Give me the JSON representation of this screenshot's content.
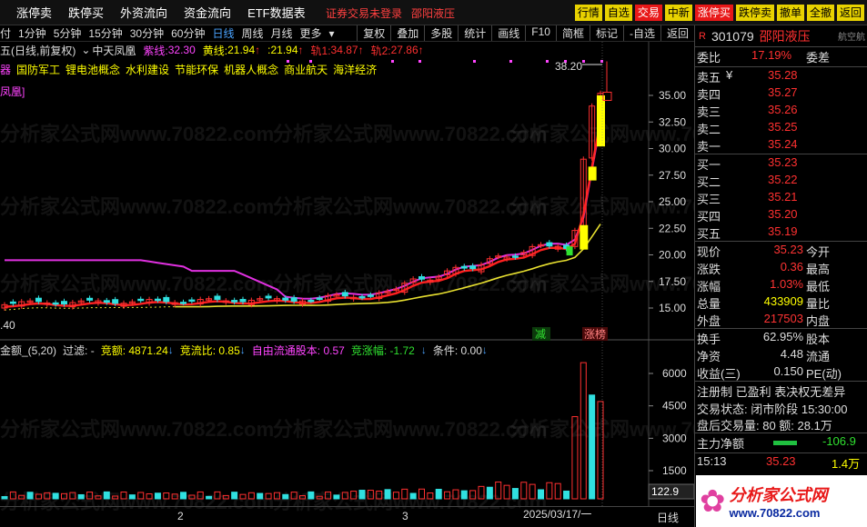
{
  "menu": [
    "涨停卖",
    "跌停买",
    "外资流向",
    "资金流向",
    "ETF数据表"
  ],
  "menu_tools": {
    "notice": "证券交易未登录",
    "stock": "邵阳液压"
  },
  "menu_buttons": [
    "行情",
    "自选",
    "交易",
    "中新",
    "涨停买",
    "跌停卖",
    "撤单",
    "全撤",
    "返回"
  ],
  "periods": [
    "付",
    "1分钟",
    "5分钟",
    "15分钟",
    "30分钟",
    "60分钟",
    "日线",
    "周线",
    "月线",
    "更多"
  ],
  "active_period": "日线",
  "chart_buttons": [
    "复权",
    "叠加",
    "多股",
    "统计",
    "画线",
    "F10",
    "简框",
    "标记",
    "-自选",
    "返回"
  ],
  "ma": {
    "title": "五(日线,前复权)",
    "fenghuang": "中天凤凰",
    "zi_label": "紫线:",
    "zi": "32.30",
    "huang_label": "黄线:",
    "huang": "21.94",
    "sep": ":",
    "sep_val": "21.94",
    "gui1_label": "轨1:",
    "gui1": "34.87",
    "gui2_label": "轨2:",
    "gui2": "27.86",
    "arrow": "↑"
  },
  "concepts": [
    "国防军工",
    "锂电池概念",
    "水利建设",
    "节能环保",
    "机器人概念",
    "商业航天",
    "海洋经济"
  ],
  "concept_prefix": "器",
  "feng_label": "凤凰]",
  "price_axis": [
    "35.00",
    "32.50",
    "30.00",
    "27.50",
    "25.00",
    "22.50",
    "20.00",
    "17.50",
    "15.00"
  ],
  "high_label": "38.20",
  "low_label": ".40",
  "tags": {
    "jian": "减",
    "zhangting": "涨榜"
  },
  "indicator": {
    "name": "金额_(5,20)",
    "filter": "过滤: -",
    "jingxiao": "竞额: 4871.24",
    "arr1": "↓",
    "jlb": "竞流比: 0.85",
    "arr2": "↓",
    "zyltgb": "自由流通股本: 0.57",
    "jzf": "竞涨幅: -1.72",
    "arr3": "↓",
    "cond": "条件: 0.00",
    "arr4": "↓"
  },
  "vol_axis": [
    "6000",
    "4500",
    "3000",
    "1500"
  ],
  "vol_last": "122.9",
  "date_label": "2025/03/17/一",
  "month_labels": [
    "2",
    "3"
  ],
  "bottom_right": "日线",
  "watermark": "分析家公式网www.70822.com",
  "rp": {
    "code": "301079",
    "name": "邵阳液压",
    "r_badge": "R",
    "right_tab": "航空航",
    "weibi_l": "委比",
    "weibi_v": "17.19%",
    "weicha_l": "委差",
    "sells": [
      {
        "l": "卖五",
        "p": "35.28"
      },
      {
        "l": "卖四",
        "p": "35.27"
      },
      {
        "l": "卖三",
        "p": "35.26"
      },
      {
        "l": "卖二",
        "p": "35.25"
      },
      {
        "l": "卖一",
        "p": "35.24"
      }
    ],
    "yen": "¥",
    "buys": [
      {
        "l": "买一",
        "p": "35.23"
      },
      {
        "l": "买二",
        "p": "35.22"
      },
      {
        "l": "买三",
        "p": "35.21"
      },
      {
        "l": "买四",
        "p": "35.20"
      },
      {
        "l": "买五",
        "p": "35.19"
      }
    ],
    "stats": [
      {
        "l": "现价",
        "v": "35.23",
        "r": "今开",
        "c": "#ff3333"
      },
      {
        "l": "涨跌",
        "v": "0.36",
        "r": "最高",
        "c": "#ff3333"
      },
      {
        "l": "涨幅",
        "v": "1.03%",
        "r": "最低",
        "c": "#ff3333"
      },
      {
        "l": "总量",
        "v": "433909",
        "r": "量比",
        "c": "#ffff00"
      },
      {
        "l": "外盘",
        "v": "217503",
        "r": "内盘",
        "c": "#ff3333"
      }
    ],
    "stats2": [
      {
        "l": "换手",
        "v": "62.95%",
        "r": "股本",
        "c": "#ddd"
      },
      {
        "l": "净资",
        "v": "4.48",
        "r": "流通",
        "c": "#ddd"
      },
      {
        "l": "收益(三)",
        "v": "0.150",
        "r": "PE(动)",
        "c": "#ddd"
      }
    ],
    "reg": "注册制 已盈利 表决权无差异",
    "trade_state": "交易状态: 闭市阶段 15:30:00",
    "after_hours": "盘后交易量: 80  额: 28.1万",
    "main_flow_l": "主力净额",
    "main_flow_v": "-106.9",
    "tick_time": "15:13",
    "tick_price": "35.23",
    "tick_vol": "1.4万"
  },
  "logo_text": "分析家公式网",
  "logo_url": "www.70822.com",
  "chart_data": {
    "type": "candlestick",
    "series": [
      {
        "name": "紫线",
        "value": 32.3
      },
      {
        "name": "黄线",
        "value": 21.94
      },
      {
        "name": "轨1",
        "value": 34.87
      },
      {
        "name": "轨2",
        "value": 27.86
      }
    ],
    "ylim": [
      13.5,
      38.2
    ],
    "last_close": 35.23,
    "high": 38.2
  }
}
